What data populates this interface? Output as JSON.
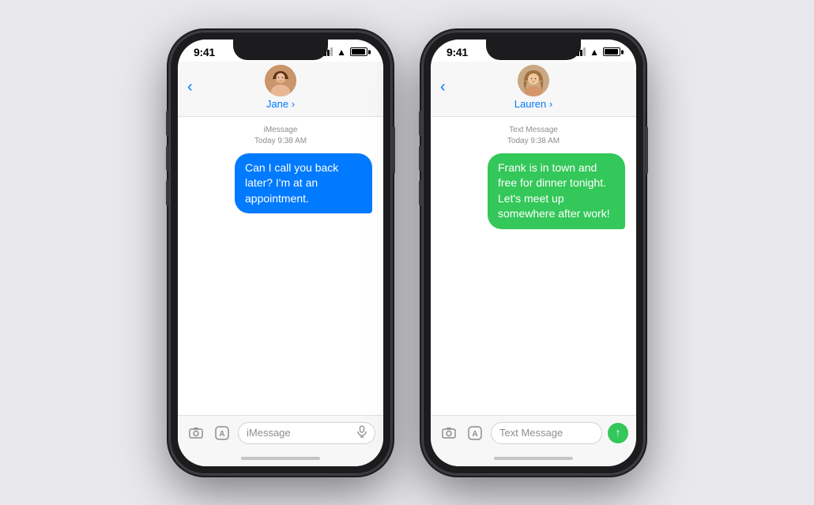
{
  "background": "#e8e8ed",
  "phones": [
    {
      "id": "phone-imessage",
      "contact_name": "Jane",
      "time": "9:41",
      "message_type": "iMessage",
      "message_date": "Today 9:38 AM",
      "bubble_text": "Can I call you back later? I'm at an appointment.",
      "bubble_color": "blue",
      "input_placeholder": "iMessage",
      "send_type": "mic",
      "avatar_type": "jane"
    },
    {
      "id": "phone-sms",
      "contact_name": "Lauren",
      "time": "9:41",
      "message_type": "Text Message",
      "message_date": "Today 9:38 AM",
      "bubble_text": "Frank is in town and free for dinner tonight. Let's meet up somewhere after work!",
      "bubble_color": "green",
      "input_placeholder": "Text Message",
      "send_type": "arrow",
      "avatar_type": "lauren"
    }
  ],
  "labels": {
    "back": "<",
    "camera_icon": "📷",
    "appstore_icon": "A",
    "contact_chevron": ">"
  }
}
